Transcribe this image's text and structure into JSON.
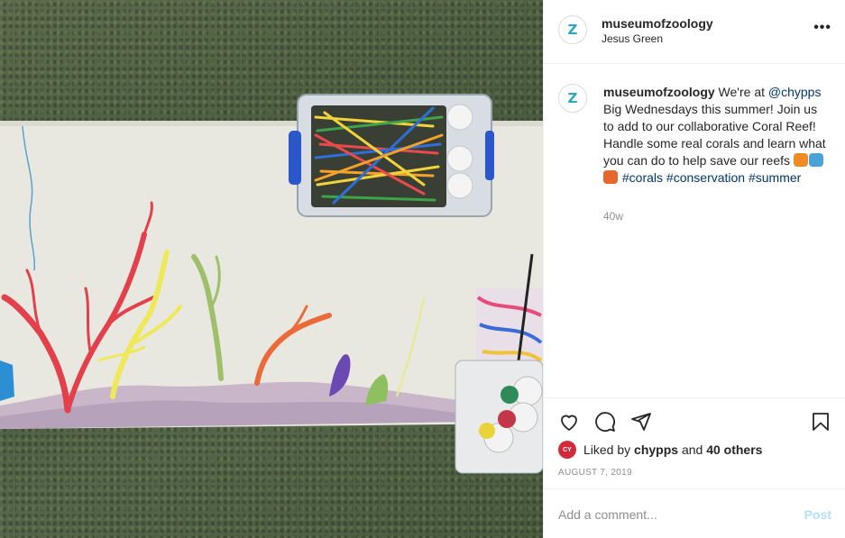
{
  "header": {
    "avatar_letter": "Z",
    "username": "museumofzoology",
    "location": "Jesus Green",
    "more_icon": "more-horizontal-icon"
  },
  "caption": {
    "avatar_letter": "Z",
    "username": "museumofzoology",
    "text_1": " We're at ",
    "mention": "@chypps",
    "text_2": " Big Wednesdays this summer! Join us to add to our collaborative Coral Reef! Handle some real corals and learn what you can do to help save our reefs ",
    "emojis": [
      {
        "name": "tropical-fish-emoji",
        "color": "#f08a24"
      },
      {
        "name": "dolphin-emoji",
        "color": "#4aa3d8"
      },
      {
        "name": "octopus-emoji",
        "color": "#e8662e"
      }
    ],
    "hashtags": [
      "#corals",
      "#conservation",
      "#summer"
    ],
    "time_ago": "40w"
  },
  "actions": {
    "like_icon": "heart-icon",
    "comment_icon": "comment-icon",
    "share_icon": "share-icon",
    "save_icon": "bookmark-icon",
    "likes_prefix": "Liked by ",
    "liked_by_user": "chypps",
    "likes_middle": " and ",
    "likes_count": "40 others",
    "date": "AUGUST 7, 2019"
  },
  "comment": {
    "placeholder": "Add a comment...",
    "post_label": "Post"
  },
  "colors": {
    "hashtag": "#00376b",
    "post_disabled": "#b2dffc",
    "muted": "#8e8e8e",
    "brand_teal": "#29a7c3"
  }
}
